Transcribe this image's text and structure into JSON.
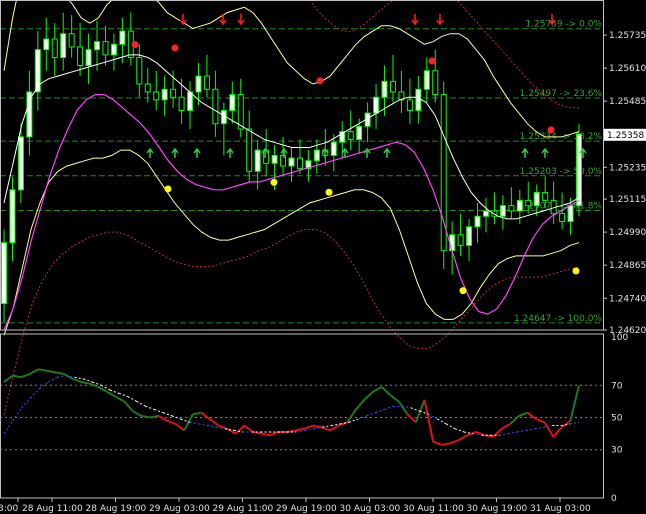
{
  "colors": {
    "background": "#000000",
    "axis": "#c0c0c0",
    "bull_candle": "#ffffff",
    "bear_candle": "#000000",
    "candle_wick": "#00ff00",
    "candle_body_bull": "#f4fff0",
    "fib": "#1f8a1f",
    "fib_text": "#2fa52f",
    "bb_inner": "#ffffff",
    "bb_mid": "#ffff99",
    "bb_outer": "#c03030",
    "ma": "#ff40ff",
    "fractal_up": "#ff2020",
    "fractal_down": "#ffff00",
    "arrow_up": "#2ecc40",
    "arrow_down": "#ff2020",
    "osc_green": "#1f7a1f",
    "osc_red": "#e01010",
    "osc_signal_blue": "#3050ff",
    "osc_signal_white": "#ffffff",
    "osc_levels": "#808080",
    "price_label_bg": "#ffffff",
    "price_label_fg": "#000000"
  },
  "chart_data": {
    "type": "candlestick",
    "price_axis": [
      "1.25735",
      "1.25610",
      "1.25485",
      "1.25360",
      "1.25235",
      "1.25115",
      "1.24990",
      "1.24865",
      "1.24740",
      "1.24620"
    ],
    "current_price": "1.25358",
    "ylim": [
      1.2462,
      1.2586
    ],
    "fib_levels": [
      {
        "price": 1.25759,
        "label": "1.25759 -> 0.0%"
      },
      {
        "price": 1.25497,
        "label": "1.25497 -> 23.6%"
      },
      {
        "price": 1.25334,
        "label": "1.25334 -> 38.2%"
      },
      {
        "price": 1.25203,
        "label": "1.25203 -> 50.0%"
      },
      {
        "price": 1.25072,
        "label": "1.25072 -> 61.8%"
      },
      {
        "price": 1.24647,
        "label": "1.24647 -> 100.0%"
      }
    ],
    "time_axis": [
      "3:00",
      "28 Aug 11:00",
      "28 Aug 19:00",
      "29 Aug 03:00",
      "29 Aug 11:00",
      "29 Aug 19:00",
      "30 Aug 03:00",
      "30 Aug 11:00",
      "30 Aug 19:00",
      "31 Aug 03:00"
    ],
    "osc_axis": [
      "100",
      "70",
      "50",
      "30",
      "0"
    ],
    "osc_levels": [
      70,
      50,
      30
    ],
    "candles": [
      [
        1.2472,
        1.25,
        1.2465,
        1.2495
      ],
      [
        1.2495,
        1.252,
        1.2488,
        1.2515
      ],
      [
        1.2515,
        1.254,
        1.251,
        1.2535
      ],
      [
        1.2535,
        1.256,
        1.2528,
        1.2552
      ],
      [
        1.2552,
        1.2575,
        1.2545,
        1.2568
      ],
      [
        1.2568,
        1.258,
        1.256,
        1.2572
      ],
      [
        1.2572,
        1.2578,
        1.2558,
        1.2565
      ],
      [
        1.2565,
        1.2582,
        1.256,
        1.2574
      ],
      [
        1.2574,
        1.2581,
        1.2565,
        1.2569
      ],
      [
        1.2569,
        1.2578,
        1.2558,
        1.2562
      ],
      [
        1.2562,
        1.2574,
        1.2555,
        1.2568
      ],
      [
        1.2568,
        1.2579,
        1.256,
        1.2571
      ],
      [
        1.2571,
        1.2577,
        1.2562,
        1.2566
      ],
      [
        1.2566,
        1.2574,
        1.256,
        1.257
      ],
      [
        1.257,
        1.258,
        1.2563,
        1.2575
      ],
      [
        1.2575,
        1.2582,
        1.2562,
        1.2565
      ],
      [
        1.2565,
        1.257,
        1.255,
        1.2555
      ],
      [
        1.2555,
        1.2561,
        1.2548,
        1.2552
      ],
      [
        1.2552,
        1.256,
        1.2545,
        1.2549
      ],
      [
        1.2549,
        1.2558,
        1.2543,
        1.2553
      ],
      [
        1.2553,
        1.256,
        1.2546,
        1.255
      ],
      [
        1.255,
        1.2557,
        1.254,
        1.2545
      ],
      [
        1.2545,
        1.2556,
        1.2538,
        1.2552
      ],
      [
        1.2552,
        1.2563,
        1.2547,
        1.2558
      ],
      [
        1.2558,
        1.2566,
        1.255,
        1.2553
      ],
      [
        1.2553,
        1.256,
        1.2535,
        1.254
      ],
      [
        1.254,
        1.2548,
        1.2528,
        1.2545
      ],
      [
        1.2545,
        1.2556,
        1.254,
        1.2551
      ],
      [
        1.2551,
        1.2557,
        1.2535,
        1.2538
      ],
      [
        1.2538,
        1.2545,
        1.2518,
        1.2522
      ],
      [
        1.2522,
        1.2534,
        1.2515,
        1.253
      ],
      [
        1.253,
        1.2538,
        1.252,
        1.2525
      ],
      [
        1.2525,
        1.2532,
        1.2515,
        1.2528
      ],
      [
        1.2528,
        1.2535,
        1.252,
        1.2524
      ],
      [
        1.2524,
        1.2531,
        1.2518,
        1.2527
      ],
      [
        1.2527,
        1.2534,
        1.2521,
        1.2523
      ],
      [
        1.2523,
        1.253,
        1.2518,
        1.2526
      ],
      [
        1.2526,
        1.2534,
        1.2521,
        1.253
      ],
      [
        1.253,
        1.2538,
        1.2524,
        1.2528
      ],
      [
        1.2528,
        1.2536,
        1.2522,
        1.2533
      ],
      [
        1.2533,
        1.2541,
        1.2527,
        1.2537
      ],
      [
        1.2537,
        1.2545,
        1.253,
        1.2534
      ],
      [
        1.2534,
        1.2542,
        1.2529,
        1.2539
      ],
      [
        1.2539,
        1.2548,
        1.2533,
        1.2544
      ],
      [
        1.2544,
        1.2555,
        1.2538,
        1.255
      ],
      [
        1.255,
        1.2562,
        1.2543,
        1.2556
      ],
      [
        1.2556,
        1.2566,
        1.2548,
        1.2552
      ],
      [
        1.2552,
        1.256,
        1.2544,
        1.2549
      ],
      [
        1.2549,
        1.2557,
        1.254,
        1.2545
      ],
      [
        1.2545,
        1.2558,
        1.254,
        1.2553
      ],
      [
        1.2553,
        1.2565,
        1.2548,
        1.256
      ],
      [
        1.256,
        1.2568,
        1.2548,
        1.2551
      ],
      [
        1.2551,
        1.2556,
        1.2485,
        1.2492
      ],
      [
        1.2492,
        1.2503,
        1.2483,
        1.2498
      ],
      [
        1.2498,
        1.2506,
        1.249,
        1.2494
      ],
      [
        1.2494,
        1.2504,
        1.2488,
        1.2501
      ],
      [
        1.2501,
        1.251,
        1.2495,
        1.2505
      ],
      [
        1.2505,
        1.2512,
        1.2499,
        1.2507
      ],
      [
        1.2507,
        1.2514,
        1.2502,
        1.2505
      ],
      [
        1.2505,
        1.2513,
        1.25,
        1.2509
      ],
      [
        1.2509,
        1.2516,
        1.2504,
        1.2507
      ],
      [
        1.2507,
        1.2515,
        1.2502,
        1.2511
      ],
      [
        1.2511,
        1.2518,
        1.2506,
        1.2509
      ],
      [
        1.2509,
        1.2517,
        1.2505,
        1.2514
      ],
      [
        1.2514,
        1.252,
        1.2508,
        1.2511
      ],
      [
        1.2511,
        1.2518,
        1.2502,
        1.2506
      ],
      [
        1.2506,
        1.2514,
        1.25,
        1.2503
      ],
      [
        1.2503,
        1.2512,
        1.2498,
        1.2509
      ],
      [
        1.2509,
        1.254,
        1.2505,
        1.2536
      ]
    ],
    "bb_upper": [
      1.256,
      1.258,
      1.2595,
      1.26,
      1.2598,
      1.2594,
      1.259,
      1.2589,
      1.2585,
      1.258,
      1.2578,
      1.258,
      1.2585,
      1.2588,
      1.259,
      1.2592,
      1.259,
      1.2588,
      1.2586,
      1.2582,
      1.258,
      1.2578,
      1.2576,
      1.2577,
      1.2578,
      1.258,
      1.2582,
      1.2583,
      1.2584,
      1.2582,
      1.2578,
      1.2573,
      1.2568,
      1.2563,
      1.256,
      1.2557,
      1.2555,
      1.2556,
      1.2558,
      1.2562,
      1.2566,
      1.257,
      1.2573,
      1.2575,
      1.2577,
      1.2577,
      1.2576,
      1.2574,
      1.2572,
      1.257,
      1.2571,
      1.2573,
      1.2574,
      1.2574,
      1.2572,
      1.2568,
      1.2564,
      1.2558,
      1.2553,
      1.2548,
      1.2544,
      1.254,
      1.2537,
      1.2535,
      1.2535,
      1.2535,
      1.2536,
      1.2537
    ],
    "bb_middle": [
      1.251,
      1.2525,
      1.254,
      1.255,
      1.2555,
      1.2557,
      1.2558,
      1.2559,
      1.256,
      1.2561,
      1.2562,
      1.2563,
      1.2564,
      1.2565,
      1.2566,
      1.2566,
      1.2565,
      1.2563,
      1.256,
      1.2557,
      1.2554,
      1.2551,
      1.2548,
      1.2546,
      1.2544,
      1.2542,
      1.254,
      1.2538,
      1.2536,
      1.2534,
      1.2533,
      1.2532,
      1.2531,
      1.2531,
      1.2531,
      1.2532,
      1.2533,
      1.2535,
      1.2537,
      1.2539,
      1.2541,
      1.2543,
      1.2545,
      1.2547,
      1.2549,
      1.255,
      1.255,
      1.2548,
      1.2543,
      1.2535,
      1.2527,
      1.252,
      1.2514,
      1.251,
      1.2507,
      1.2505,
      1.2504,
      1.2504,
      1.2505,
      1.2506,
      1.2507,
      1.2508,
      1.2509,
      1.251,
      1.2512
    ],
    "bb_lower": [
      1.246,
      1.247,
      1.2485,
      1.25,
      1.251,
      1.2518,
      1.2522,
      1.2524,
      1.2525,
      1.2526,
      1.2527,
      1.2527,
      1.2528,
      1.253,
      1.253,
      1.2528,
      1.2525,
      1.252,
      1.2515,
      1.251,
      1.2506,
      1.2502,
      1.2499,
      1.2497,
      1.2496,
      1.2496,
      1.2497,
      1.2498,
      1.2499,
      1.25,
      1.2502,
      1.2504,
      1.2506,
      1.2508,
      1.251,
      1.2511,
      1.2512,
      1.2513,
      1.2514,
      1.2515,
      1.2515,
      1.2514,
      1.2512,
      1.2508,
      1.25,
      1.249,
      1.248,
      1.2472,
      1.2468,
      1.2466,
      1.2466,
      1.2468,
      1.2472,
      1.2478,
      1.2483,
      1.2487,
      1.2489,
      1.249,
      1.249,
      1.249,
      1.249,
      1.2491,
      1.2492,
      1.2494,
      1.2495
    ],
    "bb_outer_upper": [
      1.259,
      1.261,
      1.2625,
      1.2635,
      1.2636,
      1.2634,
      1.263,
      1.2627,
      1.2624,
      1.2621,
      1.2619,
      1.2618,
      1.2617,
      1.2614,
      1.2611,
      1.2607,
      1.2603,
      1.2599,
      1.2595,
      1.2592,
      1.259,
      1.2589,
      1.2588,
      1.2589,
      1.259,
      1.2592,
      1.2595,
      1.2598,
      1.26,
      1.26,
      1.2598,
      1.2594,
      1.2589,
      1.2584,
      1.258,
      1.2577,
      1.2575,
      1.2575,
      1.2577,
      1.258,
      1.2583,
      1.2586,
      1.2588,
      1.259,
      1.2591,
      1.2592,
      1.2592,
      1.259,
      1.2587,
      1.2583,
      1.2579,
      1.2575,
      1.2571,
      1.2567,
      1.2563,
      1.2559,
      1.2555,
      1.2552,
      1.2549,
      1.2547,
      1.2546,
      1.2546
    ],
    "bb_outer_lower": [
      1.243,
      1.2445,
      1.246,
      1.2472,
      1.248,
      1.2486,
      1.249,
      1.2493,
      1.2495,
      1.2497,
      1.2498,
      1.2499,
      1.2499,
      1.2498,
      1.2496,
      1.2494,
      1.2492,
      1.249,
      1.2488,
      1.2487,
      1.2486,
      1.2486,
      1.2486,
      1.2487,
      1.2488,
      1.2489,
      1.249,
      1.2492,
      1.2493,
      1.2495,
      1.2497,
      1.2499,
      1.25,
      1.25,
      1.2499,
      1.2496,
      1.2492,
      1.2487,
      1.2481,
      1.2474,
      1.2468,
      1.2463,
      1.2459,
      1.2456,
      1.2455,
      1.2455,
      1.2457,
      1.246,
      1.2464,
      1.2468,
      1.2472,
      1.2476,
      1.2479,
      1.2481,
      1.2482,
      1.2482,
      1.2482,
      1.2482,
      1.2483,
      1.2484,
      1.2485,
      1.2486
    ],
    "ma": [
      1.2462,
      1.247,
      1.2482,
      1.2496,
      1.2508,
      1.252,
      1.253,
      1.2538,
      1.2545,
      1.2549,
      1.2551,
      1.2551,
      1.2549,
      1.2546,
      1.2543,
      1.254,
      1.2536,
      1.2531,
      1.2526,
      1.2522,
      1.2519,
      1.2517,
      1.2516,
      1.2515,
      1.2515,
      1.2516,
      1.2517,
      1.2518,
      1.2518,
      1.2519,
      1.252,
      1.2521,
      1.2522,
      1.2523,
      1.2524,
      1.2525,
      1.2526,
      1.2527,
      1.2528,
      1.2529,
      1.253,
      1.2531,
      1.2532,
      1.2533,
      1.2532,
      1.2529,
      1.2523,
      1.2515,
      1.2505,
      1.2493,
      1.2482,
      1.2474,
      1.2469,
      1.2468,
      1.247,
      1.2475,
      1.2482,
      1.249,
      1.2497,
      1.2502,
      1.2505,
      1.2507,
      1.2509,
      1.2511
    ],
    "osc": [
      72,
      76,
      75,
      77,
      80,
      79,
      78,
      77,
      74,
      72,
      71,
      69,
      66,
      63,
      60,
      54,
      51,
      50,
      51,
      48,
      46,
      42,
      52,
      53,
      49,
      45,
      43,
      40,
      45,
      41,
      40,
      39,
      41,
      41,
      42,
      43,
      45,
      44,
      42,
      45,
      47,
      55,
      61,
      66,
      69,
      64,
      60,
      52,
      47,
      61,
      35,
      33,
      34,
      36,
      39,
      41,
      39,
      38,
      43,
      46,
      51,
      53,
      49,
      47,
      38,
      44,
      48,
      70
    ],
    "osc_signal_a": [
      40,
      48,
      56,
      62,
      68,
      72,
      75,
      76,
      75,
      74,
      72,
      70,
      67,
      65,
      63,
      60,
      57,
      55,
      53,
      51,
      49,
      47,
      46,
      45,
      44,
      43,
      42,
      41,
      41,
      41,
      41,
      41,
      41,
      41,
      42,
      43,
      44,
      45,
      46,
      47,
      49,
      51,
      53,
      55,
      57,
      57,
      56,
      54,
      52,
      49,
      46,
      43,
      41,
      40,
      39,
      39,
      39,
      40,
      41,
      42,
      43,
      44,
      45,
      45,
      46,
      47
    ]
  },
  "markers": {
    "down_arrows_x": [
      183,
      223,
      241,
      415,
      440,
      552
    ],
    "up_arrows_x": [
      150,
      175,
      197,
      230,
      265,
      284,
      325,
      345,
      367,
      387,
      525,
      545,
      583
    ],
    "fractal_up": [
      [
        135,
        0.87
      ],
      [
        175,
        0.86
      ],
      [
        320,
        0.76
      ],
      [
        432,
        0.82
      ],
      [
        551,
        0.61
      ]
    ],
    "fractal_down": [
      [
        168,
        0.43
      ],
      [
        274,
        0.45
      ],
      [
        329,
        0.42
      ],
      [
        463,
        0.12
      ],
      [
        576,
        0.18
      ]
    ]
  }
}
